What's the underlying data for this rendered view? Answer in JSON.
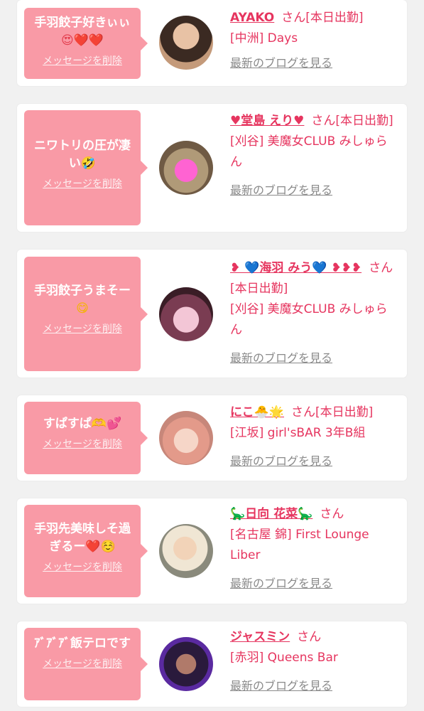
{
  "common": {
    "delete_label": "メッセージを削除",
    "blog_label": "最新のブログを見る",
    "honorific": "さん"
  },
  "accent_color": "#e6355f",
  "bubble_color": "#f99aa6",
  "entries": [
    {
      "message_text": "手羽餃子好きぃぃ",
      "message_emoji": "😍❤️❤️",
      "name": "AYAKO",
      "status": "[本日出勤]",
      "shop": "[中洲] Days"
    },
    {
      "message_text": "ニワトリの圧が凄い",
      "message_emoji": "🤣",
      "name": "♥堂島 えり♥",
      "status": "[本日出勤]",
      "shop": "[刈谷] 美魔女CLUB みしゅらん"
    },
    {
      "message_text": "手羽餃子うまそー",
      "message_emoji": "😋",
      "name": "❥ 💙海羽 みう💙 ❥❥❥",
      "status": "[本日出勤]",
      "shop": "[刈谷] 美魔女CLUB みしゅらん"
    },
    {
      "message_text": "すぱすぱ",
      "message_emoji": "🫶💕",
      "name": "にこ🐣🌟",
      "status": "[本日出勤]",
      "shop": "[江坂] girl'sBAR 3年B組"
    },
    {
      "message_text": "手羽先美味しそ過ぎるー",
      "message_emoji": "❤️☺️",
      "name": "🦕日向 花菜🦕",
      "status": "",
      "shop": "[名古屋 錦] First Lounge Liber"
    },
    {
      "message_text": "ｱﾞｱﾞｱﾞ飯テロです",
      "message_emoji": "",
      "name": "ジャスミン",
      "status": "",
      "shop": "[赤羽] Queens Bar"
    }
  ]
}
